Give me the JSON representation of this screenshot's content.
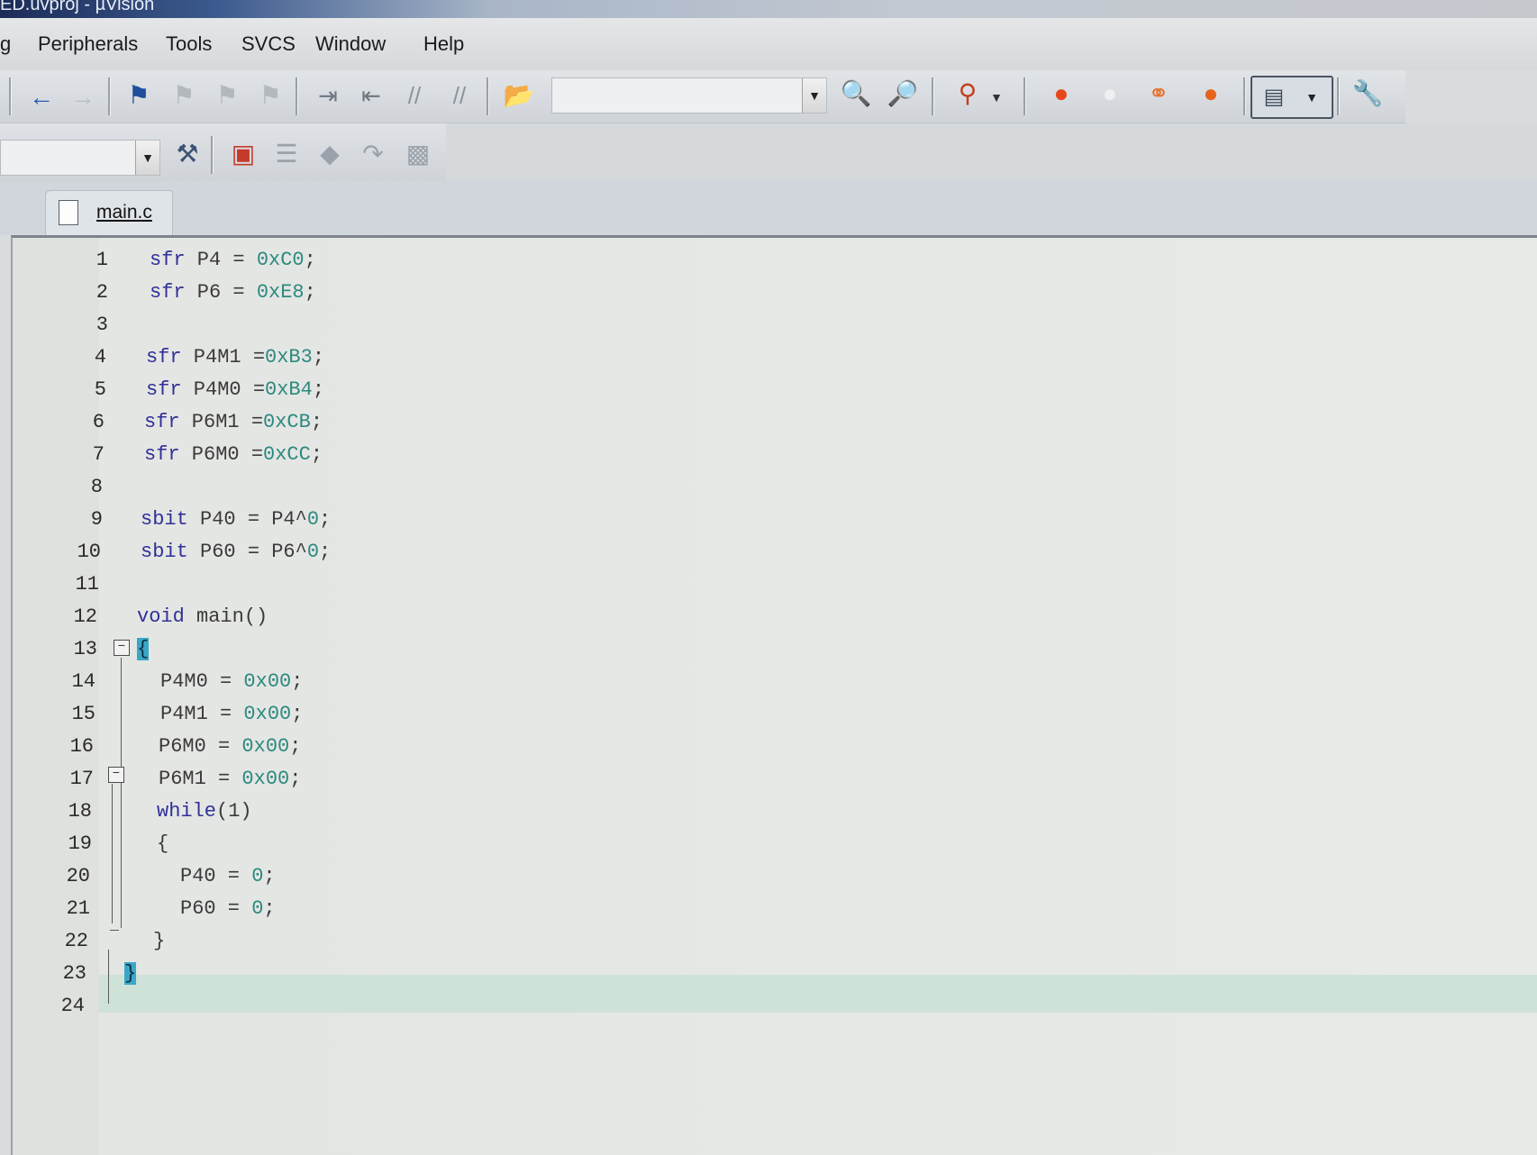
{
  "window": {
    "title": "ED.uvproj - µVision"
  },
  "menubar": {
    "items": [
      "g",
      "Peripherals",
      "Tools",
      "SVCS",
      "Window",
      "Help"
    ]
  },
  "toolbar1": {
    "target_combo_value": ""
  },
  "toolbar2": {
    "combo_value": ""
  },
  "tabs": [
    {
      "label": "main.c",
      "active": true
    }
  ],
  "editor": {
    "current_line": 23,
    "lines": [
      {
        "n": "1",
        "text": "sfr P4 = 0xC0;"
      },
      {
        "n": "2",
        "text": "sfr P6 = 0xE8;"
      },
      {
        "n": "3",
        "text": ""
      },
      {
        "n": "4",
        "text": "sfr P4M1 =0xB3;"
      },
      {
        "n": "5",
        "text": "sfr P4M0 =0xB4;"
      },
      {
        "n": "6",
        "text": "sfr P6M1 =0xCB;"
      },
      {
        "n": "7",
        "text": "sfr P6M0 =0xCC;"
      },
      {
        "n": "8",
        "text": ""
      },
      {
        "n": "9",
        "text": "sbit P40 = P4^0;"
      },
      {
        "n": "10",
        "text": "sbit P60 = P6^0;"
      },
      {
        "n": "11",
        "text": ""
      },
      {
        "n": "12",
        "text": "void main()"
      },
      {
        "n": "13",
        "text": "{"
      },
      {
        "n": "14",
        "text": "P4M0 = 0x00;"
      },
      {
        "n": "15",
        "text": "P4M1 = 0x00;"
      },
      {
        "n": "16",
        "text": "P6M0 = 0x00;"
      },
      {
        "n": "17",
        "text": "P6M1 = 0x00;"
      },
      {
        "n": "18",
        "text": "while(1)"
      },
      {
        "n": "19",
        "text": "{"
      },
      {
        "n": "20",
        "text": "P40 = 0;"
      },
      {
        "n": "21",
        "text": "P60 = 0;"
      },
      {
        "n": "22",
        "text": "}"
      },
      {
        "n": "23",
        "text": "}"
      },
      {
        "n": "24",
        "text": ""
      }
    ]
  },
  "colors": {
    "keyword": "#31309a",
    "number": "#2d8a7e",
    "brace_match": "#39a7c7",
    "current_line": "#cfe2d8"
  },
  "icons": {
    "toolbar1": [
      "back-arrow-icon",
      "forward-arrow-icon",
      "bookmark-flag-icon",
      "prev-bookmark-icon",
      "next-bookmark-icon",
      "clear-bookmarks-icon",
      "indent-icon",
      "unindent-icon",
      "comment-icon",
      "uncomment-icon",
      "find-in-files-icon",
      "find-icon",
      "incremental-find-icon",
      "debug-session-icon",
      "breakpoint-insert-icon",
      "breakpoint-enable-icon",
      "breakpoint-disable-icon",
      "breakpoint-kill-all-icon",
      "window-layout-icon",
      "configure-icon"
    ],
    "toolbar2": [
      "target-options-icon",
      "manage-components-icon",
      "file-extensions-icon",
      "select-packs-icon",
      "download-icon",
      "rebuild-icon"
    ]
  }
}
